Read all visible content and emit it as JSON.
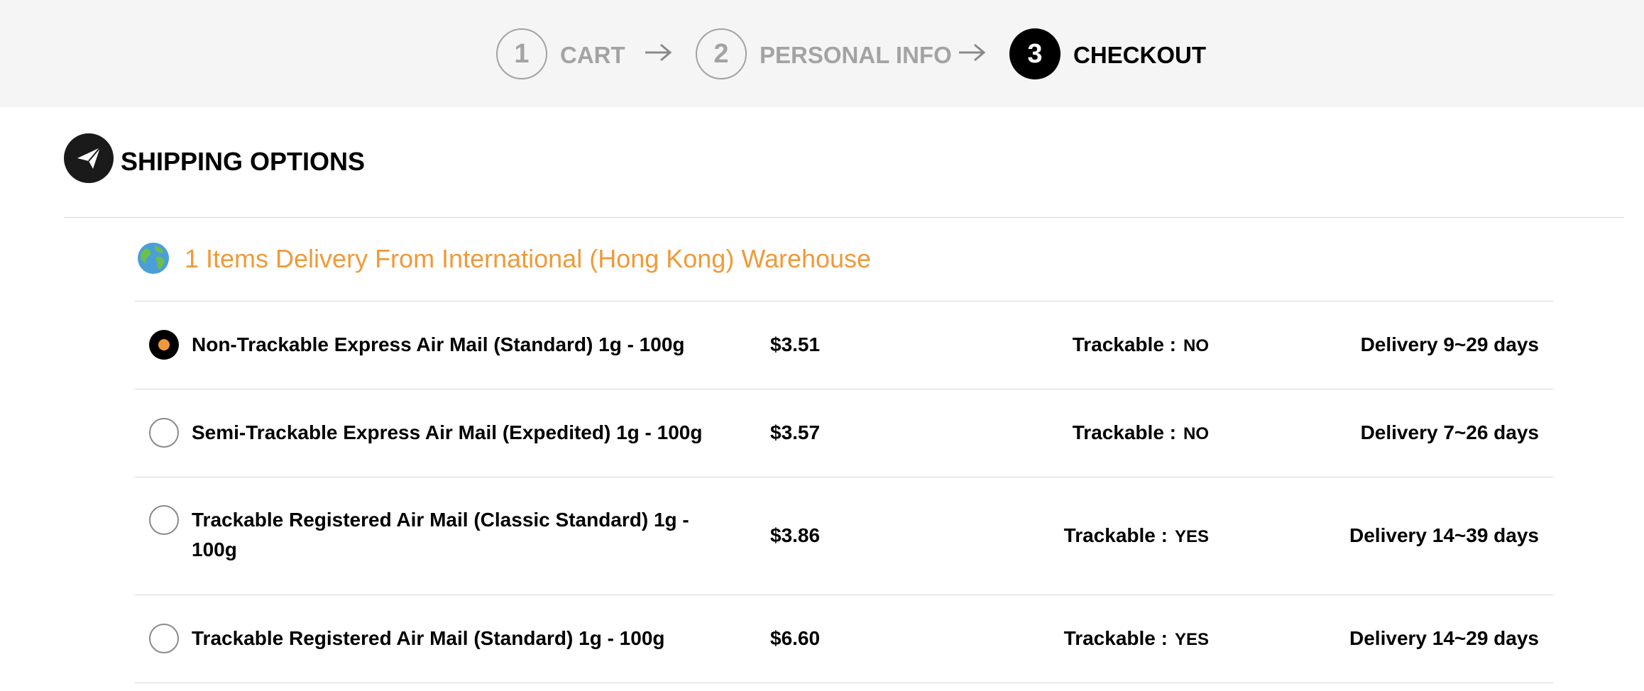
{
  "stepper": {
    "steps": [
      {
        "number": "1",
        "label": "CART"
      },
      {
        "number": "2",
        "label": "PERSONAL INFO"
      },
      {
        "number": "3",
        "label": "CHECKOUT"
      }
    ],
    "active_step": 3
  },
  "shipping": {
    "title": "SHIPPING OPTIONS",
    "icon": "paper-plane-icon"
  },
  "warehouse": {
    "icon": "globe-icon",
    "title": "1 Items Delivery From International (Hong Kong) Warehouse"
  },
  "options": [
    {
      "name": "Non-Trackable Express Air Mail (Standard) 1g - 100g",
      "price": "$3.51",
      "trackable_label": "Trackable :",
      "trackable_value": "NO",
      "delivery": "Delivery 9~29 days",
      "selected": true
    },
    {
      "name": "Semi-Trackable Express Air Mail (Expedited) 1g - 100g",
      "price": "$3.57",
      "trackable_label": "Trackable :",
      "trackable_value": "NO",
      "delivery": "Delivery 7~26 days",
      "selected": false
    },
    {
      "name": "Trackable Registered Air Mail (Classic Standard) 1g - 100g",
      "price": "$3.86",
      "trackable_label": "Trackable :",
      "trackable_value": "YES",
      "delivery": "Delivery 14~39 days",
      "selected": false
    },
    {
      "name": "Trackable Registered Air Mail (Standard) 1g - 100g",
      "price": "$6.60",
      "trackable_label": "Trackable :",
      "trackable_value": "YES",
      "delivery": "Delivery 14~29 days",
      "selected": false
    }
  ],
  "colors": {
    "accent": "#ef9a3a",
    "active_step": "#000000",
    "inactive_step": "#a3a3a3",
    "stepper_bg": "#f5f5f5"
  }
}
